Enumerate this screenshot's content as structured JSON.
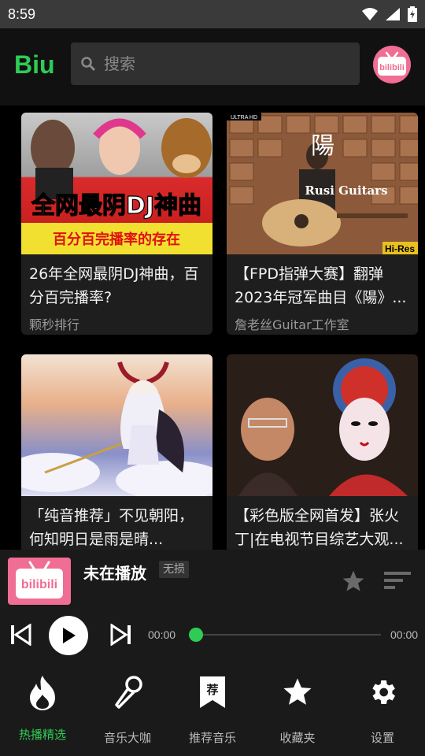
{
  "status_bar": {
    "time": "8:59"
  },
  "header": {
    "logo": "Biu",
    "search_placeholder": "搜索",
    "avatar_text": "bilibili"
  },
  "cards": [
    {
      "title": "26年全网最阴DJ神曲，百分百完播率?",
      "author": "颗秒排行",
      "thumb_text": "全网最阴DJ神曲",
      "thumb_subtext": "百分百完播率的存在"
    },
    {
      "title": "【FPD指弹大赛】翻弹2023年冠军曲目《陽》...",
      "author": "詹老丝Guitar工作室",
      "thumb_text": "陽",
      "thumb_subtext": "Rusi Guitars",
      "thumb_badge_tl": "ULTRA HD",
      "thumb_badge_br": "Hi-Res"
    },
    {
      "title": "「纯音推荐」不见朝阳，何知明日是雨是晴...",
      "author": ""
    },
    {
      "title": "【彩色版全网首发】张火丁|在电视节目综艺大观...",
      "author": ""
    }
  ],
  "player": {
    "cover_text": "bilibili",
    "title": "未在播放",
    "quality": "无损",
    "time_current": "00:00",
    "time_total": "00:00",
    "progress": 0
  },
  "nav": [
    {
      "label": "热播精选",
      "icon": "flame-icon",
      "active": true
    },
    {
      "label": "音乐大咖",
      "icon": "microphone-icon",
      "active": false
    },
    {
      "label": "推荐音乐",
      "icon": "bookmark-icon",
      "active": false,
      "icon_text": "荐"
    },
    {
      "label": "收藏夹",
      "icon": "star-icon",
      "active": false
    },
    {
      "label": "设置",
      "icon": "gear-icon",
      "active": false
    }
  ],
  "colors": {
    "accent": "#2ecc55",
    "brand_pink": "#f06d93"
  }
}
